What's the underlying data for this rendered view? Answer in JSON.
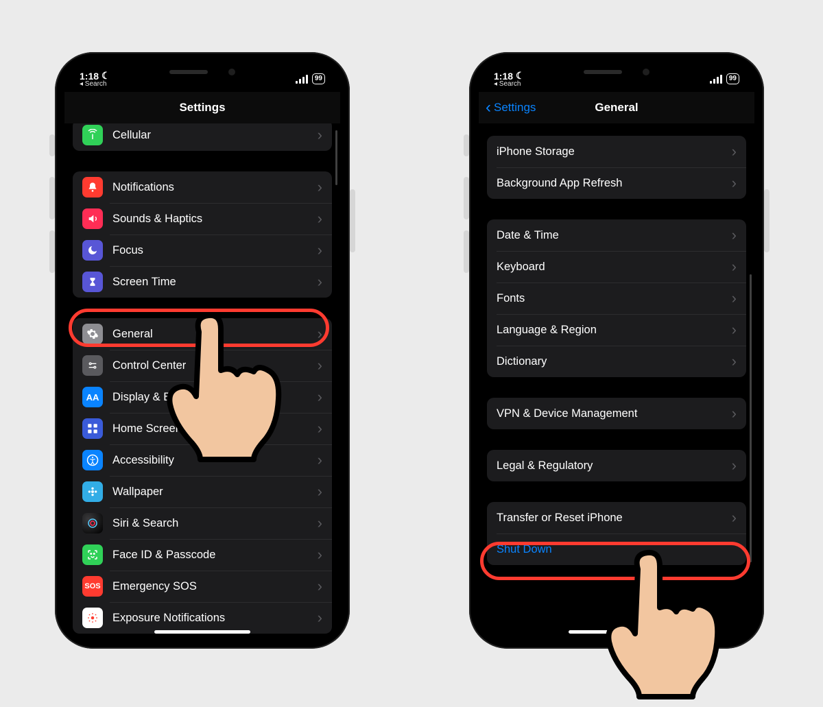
{
  "status": {
    "time": "1:18",
    "moon": "☾",
    "back_hint": "◂ Search",
    "battery": "99"
  },
  "phoneA": {
    "title": "Settings",
    "group0": {
      "cellular": "Cellular"
    },
    "group1": {
      "notifications": "Notifications",
      "sounds": "Sounds & Haptics",
      "focus": "Focus",
      "screentime": "Screen Time"
    },
    "group2": {
      "general": "General",
      "control": "Control Center",
      "display": "Display & Brightness",
      "home": "Home Screen",
      "accessibility": "Accessibility",
      "wallpaper": "Wallpaper",
      "siri": "Siri & Search",
      "faceid": "Face ID & Passcode",
      "sos": "Emergency SOS",
      "exposure": "Exposure Notifications"
    }
  },
  "phoneB": {
    "back": "Settings",
    "title": "General",
    "group0": {
      "storage": "iPhone Storage",
      "background": "Background App Refresh"
    },
    "group1": {
      "date": "Date & Time",
      "keyboard": "Keyboard",
      "fonts": "Fonts",
      "lang": "Language & Region",
      "dict": "Dictionary"
    },
    "group2": {
      "vpn": "VPN & Device Management"
    },
    "group3": {
      "legal": "Legal & Regulatory"
    },
    "group4": {
      "transfer": "Transfer or Reset iPhone",
      "shutdown": "Shut Down"
    }
  }
}
